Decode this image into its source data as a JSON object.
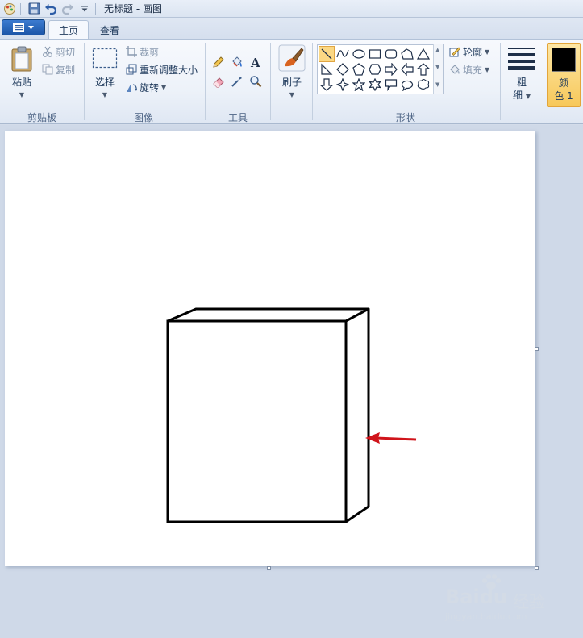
{
  "window": {
    "title": "无标题 - 画图"
  },
  "tabs": [
    {
      "label": "主页",
      "active": true
    },
    {
      "label": "查看",
      "active": false
    }
  ],
  "ribbon": {
    "clipboard": {
      "group_label": "剪贴板",
      "paste": "粘贴",
      "cut": "剪切",
      "copy": "复制"
    },
    "image": {
      "group_label": "图像",
      "select": "选择",
      "crop": "裁剪",
      "resize": "重新调整大小",
      "rotate": "旋转"
    },
    "tools": {
      "group_label": "工具"
    },
    "brushes": {
      "label": "刷子"
    },
    "shapes": {
      "group_label": "形状",
      "outline": "轮廓",
      "fill": "填充"
    },
    "size": {
      "label_line1": "粗",
      "label_line2": "细"
    },
    "color1": {
      "label_line1": "颜",
      "label_line2": "色 1",
      "value": "#000000"
    }
  },
  "watermark": {
    "brand": "Baidu",
    "brand_cn": "经验",
    "url": "jingyan.baidu.com"
  },
  "colors": {
    "accent": "#f7c85a",
    "arrow": "#d0141b"
  }
}
